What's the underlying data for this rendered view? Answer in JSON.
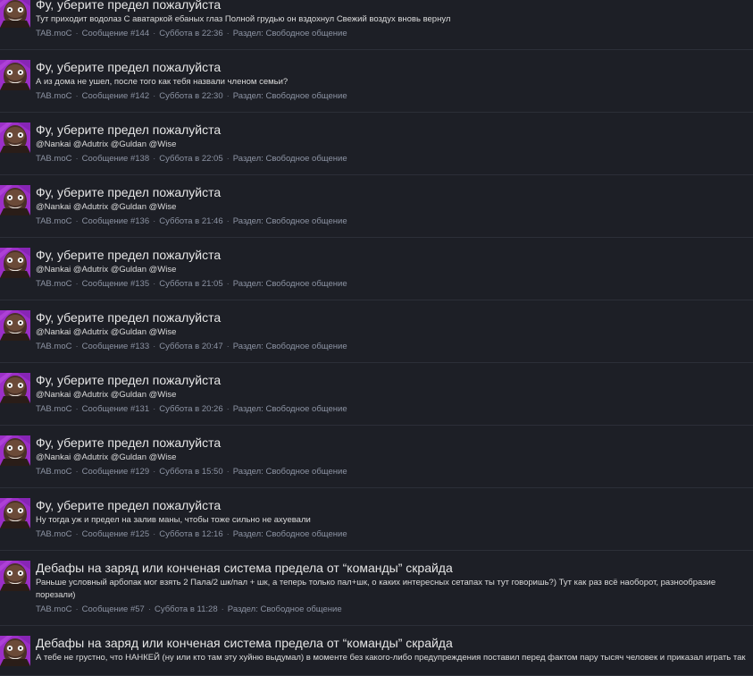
{
  "posts": [
    {
      "title": "Фу, уберите предел пожалуйста",
      "snippet": "Тут приходит водолаз С аватаркой ебаных глаз Полной грудью он вздохнул Свежий воздух вновь вернул",
      "author": "TAB.moC",
      "message": "Сообщение #144",
      "date": "Суббота в 22:36",
      "section": "Раздел: Свободное общение"
    },
    {
      "title": "Фу, уберите предел пожалуйста",
      "snippet": "А из дома не ушел, после того как тебя назвали членом семьи?",
      "author": "TAB.moC",
      "message": "Сообщение #142",
      "date": "Суббота в 22:30",
      "section": "Раздел: Свободное общение"
    },
    {
      "title": "Фу, уберите предел пожалуйста",
      "snippet": "@Nankai @Adutrix @Guldan @Wise",
      "author": "TAB.moC",
      "message": "Сообщение #138",
      "date": "Суббота в 22:05",
      "section": "Раздел: Свободное общение"
    },
    {
      "title": "Фу, уберите предел пожалуйста",
      "snippet": "@Nankai @Adutrix @Guldan @Wise",
      "author": "TAB.moC",
      "message": "Сообщение #136",
      "date": "Суббота в 21:46",
      "section": "Раздел: Свободное общение"
    },
    {
      "title": "Фу, уберите предел пожалуйста",
      "snippet": "@Nankai @Adutrix @Guldan @Wise",
      "author": "TAB.moC",
      "message": "Сообщение #135",
      "date": "Суббота в 21:05",
      "section": "Раздел: Свободное общение"
    },
    {
      "title": "Фу, уберите предел пожалуйста",
      "snippet": "@Nankai @Adutrix @Guldan @Wise",
      "author": "TAB.moC",
      "message": "Сообщение #133",
      "date": "Суббота в 20:47",
      "section": "Раздел: Свободное общение"
    },
    {
      "title": "Фу, уберите предел пожалуйста",
      "snippet": "@Nankai @Adutrix @Guldan @Wise",
      "author": "TAB.moC",
      "message": "Сообщение #131",
      "date": "Суббота в 20:26",
      "section": "Раздел: Свободное общение"
    },
    {
      "title": "Фу, уберите предел пожалуйста",
      "snippet": "@Nankai @Adutrix @Guldan @Wise",
      "author": "TAB.moC",
      "message": "Сообщение #129",
      "date": "Суббота в 15:50",
      "section": "Раздел: Свободное общение"
    },
    {
      "title": "Фу, уберите предел пожалуйста",
      "snippet": "Ну тогда уж и предел на залив маны, чтобы тоже сильно не ахуевали",
      "author": "TAB.moC",
      "message": "Сообщение #125",
      "date": "Суббота в 12:16",
      "section": "Раздел: Свободное общение"
    },
    {
      "title": "Дебафы на заряд или конченая система предела от “команды” скрайда",
      "snippet": "Раньше условный арбопак мог взять 2 Пала/2 шк/пал + шк, а теперь только пал+шк, о каких интересных сетапах ты тут говоришь?) Тут как раз всё наоборот, разнообразие порезали)",
      "author": "TAB.moC",
      "message": "Сообщение #57",
      "date": "Суббота в 11:28",
      "section": "Раздел: Свободное общение"
    },
    {
      "title": "Дебафы на заряд или конченая система предела от “команды” скрайда",
      "snippet": "А тебе не грустно, что НАНКЕЙ (ну или кто там эту хуйню выдумал) в моменте без какого-либо предупреждения поставил перед фактом пару тысяч человек и приказал играть так",
      "author": "",
      "message": "",
      "date": "",
      "section": ""
    }
  ],
  "avatar": {
    "icon": "user-avatar-icon",
    "bg": "#9b2fc7",
    "face": "#3b2a22"
  },
  "meta_separator": "·"
}
